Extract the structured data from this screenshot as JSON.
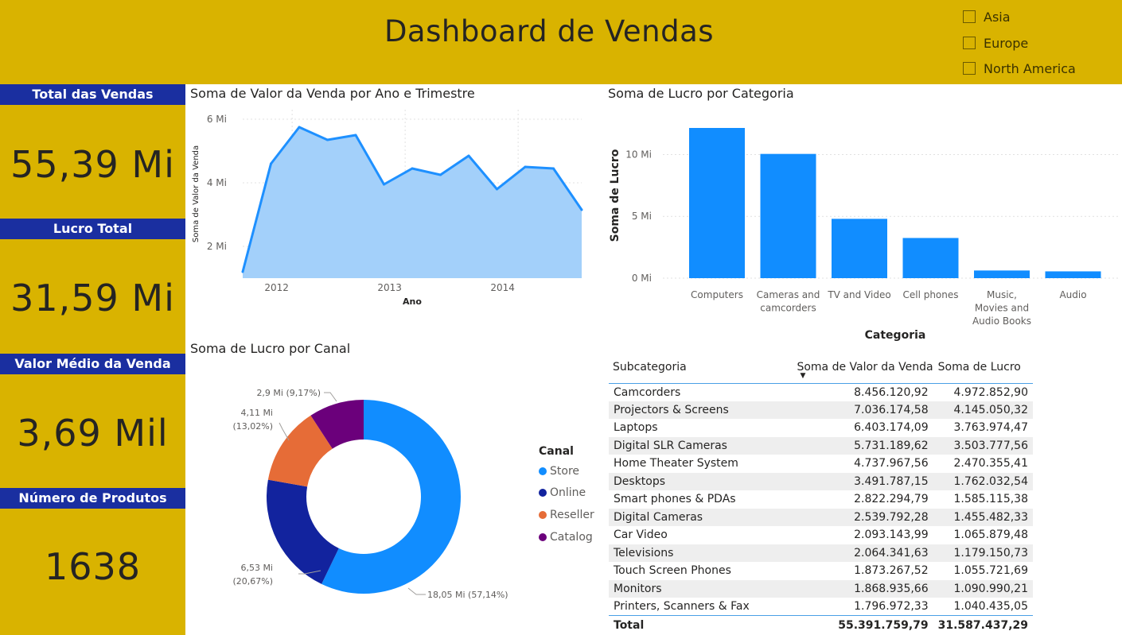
{
  "header": {
    "title": "Dashboard de Vendas",
    "slicer": [
      {
        "label": "Asia",
        "checked": false
      },
      {
        "label": "Europe",
        "checked": false
      },
      {
        "label": "North America",
        "checked": false
      }
    ]
  },
  "kpis": [
    {
      "title": "Total das Vendas",
      "value": "55,39 Mi"
    },
    {
      "title": "Lucro Total",
      "value": "31,59 Mi"
    },
    {
      "title": "Valor Médio da Venda",
      "value": "3,69 Mil"
    },
    {
      "title": "Número de Produtos",
      "value": "1638"
    }
  ],
  "colors": {
    "accent_yellow": "#D9B300",
    "kpi_blue": "#1A2FA0",
    "bar_blue": "#118DFF",
    "area_fill": "#A3D0FA",
    "line_blue": "#1E90FF",
    "store": "#118DFF",
    "online": "#12239E",
    "reseller": "#E66C37",
    "catalog": "#6B007B"
  },
  "chart_data": [
    {
      "type": "area",
      "title": "Soma de Valor da Venda por Ano e Trimestre",
      "xlabel": "Ano",
      "ylabel": "Soma de Valor da Venda",
      "x_ticks": [
        "2012",
        "2013",
        "2014"
      ],
      "y_ticks": [
        "2 Mi",
        "4 Mi",
        "6 Mi"
      ],
      "ylim": [
        1.0,
        6.3
      ],
      "x": [
        "2011 Q4",
        "2012 Q1",
        "2012 Q2",
        "2012 Q3",
        "2012 Q4",
        "2013 Q1",
        "2013 Q2",
        "2013 Q3",
        "2013 Q4",
        "2014 Q1",
        "2014 Q2",
        "2014 Q3",
        "2014 Q4"
      ],
      "values": [
        1.2,
        4.6,
        5.75,
        5.35,
        5.5,
        3.95,
        4.45,
        4.25,
        4.85,
        3.8,
        4.5,
        4.45,
        3.15
      ],
      "grid": true
    },
    {
      "type": "bar",
      "title": "Soma de Lucro por Categoria",
      "xlabel": "Categoria",
      "ylabel": "Soma de Lucro",
      "categories": [
        "Computers",
        "Cameras and camcorders",
        "TV and Video",
        "Cell phones",
        "Music, Movies and Audio Books",
        "Audio"
      ],
      "values": [
        12.15,
        10.05,
        4.8,
        3.25,
        0.62,
        0.55
      ],
      "y_ticks": [
        "0 Mi",
        "5 Mi",
        "10 Mi"
      ],
      "ylim": [
        0,
        13.5
      ],
      "grid": true
    },
    {
      "type": "pie",
      "title": "Soma de Lucro por Canal",
      "legend_title": "Canal",
      "legend_position": "right",
      "series": [
        {
          "name": "Store",
          "value": 18.05,
          "label": "18,05 Mi (57,14%)"
        },
        {
          "name": "Online",
          "value": 6.53,
          "label_value": "6,53 Mi",
          "label_pct": "(20,67%)"
        },
        {
          "name": "Reseller",
          "value": 4.11,
          "label_value": "4,11 Mi",
          "label_pct": "(13,02%)"
        },
        {
          "name": "Catalog",
          "value": 2.9,
          "label": "2,9 Mi (9,17%)"
        }
      ]
    }
  ],
  "table": {
    "headers": [
      "Subcategoria",
      "Soma de Valor da Venda",
      "Soma de Lucro"
    ],
    "rows": [
      [
        "Camcorders",
        "8.456.120,92",
        "4.972.852,90"
      ],
      [
        "Projectors & Screens",
        "7.036.174,58",
        "4.145.050,32"
      ],
      [
        "Laptops",
        "6.403.174,09",
        "3.763.974,47"
      ],
      [
        "Digital SLR Cameras",
        "5.731.189,62",
        "3.503.777,56"
      ],
      [
        "Home Theater System",
        "4.737.967,56",
        "2.470.355,41"
      ],
      [
        "Desktops",
        "3.491.787,15",
        "1.762.032,54"
      ],
      [
        "Smart phones & PDAs",
        "2.822.294,79",
        "1.585.115,38"
      ],
      [
        "Digital Cameras",
        "2.539.792,28",
        "1.455.482,33"
      ],
      [
        "Car Video",
        "2.093.143,99",
        "1.065.879,48"
      ],
      [
        "Televisions",
        "2.064.341,63",
        "1.179.150,73"
      ],
      [
        "Touch Screen Phones",
        "1.873.267,52",
        "1.055.721,69"
      ],
      [
        "Monitors",
        "1.868.935,66",
        "1.090.990,21"
      ],
      [
        "Printers, Scanners & Fax",
        "1.796.972,33",
        "1.040.435,05"
      ]
    ],
    "total": [
      "Total",
      "55.391.759,79",
      "31.587.437,29"
    ],
    "sort_icon": "sort-descending-icon"
  }
}
